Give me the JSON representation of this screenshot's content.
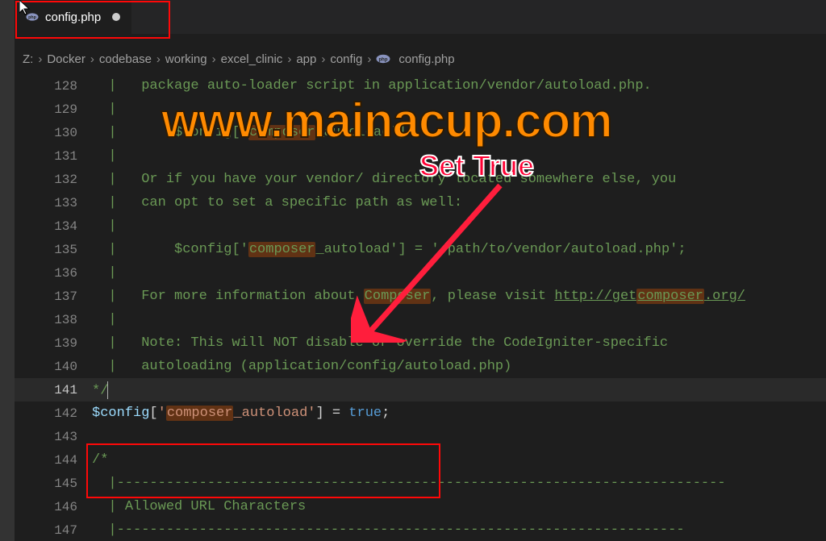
{
  "tab": {
    "filename": "config.php"
  },
  "breadcrumbs": {
    "items": [
      "Z:",
      "Docker",
      "codebase",
      "working",
      "excel_clinic",
      "app",
      "config",
      "config.php"
    ],
    "sep": "›"
  },
  "watermark": "www.mainacup.com",
  "annotation": "Set True",
  "lines": {
    "128": {
      "num": "128",
      "pipe": "  |   ",
      "text": "package auto-loader script in application/vendor/autoload.php."
    },
    "129": {
      "num": "129",
      "pipe": "  |"
    },
    "130": {
      "num": "130",
      "pipe": "  |       ",
      "v": "$config",
      "b1": "[",
      "s1": "'",
      "hl": "composer",
      "s2": "_autoload'",
      "b2": "]"
    },
    "131": {
      "num": "131",
      "pipe": "  |"
    },
    "132": {
      "num": "132",
      "pipe": "  |   ",
      "text": "Or if you have your vendor/ directory located somewhere else, you"
    },
    "133": {
      "num": "133",
      "pipe": "  |   ",
      "text": "can opt to set a specific path as well:"
    },
    "134": {
      "num": "134",
      "pipe": "  |"
    },
    "135": {
      "num": "135",
      "pipe": "  |       ",
      "v": "$config",
      "b1": "[",
      "s1": "'",
      "hl": "composer",
      "s2": "_autoload'",
      "b2": "]",
      "eq": " = ",
      "s3": "'/path/to/vendor/autoload.php'",
      "semi": ";"
    },
    "136": {
      "num": "136",
      "pipe": "  |"
    },
    "137": {
      "num": "137",
      "pipe": "  |   ",
      "t1": "For more information about ",
      "hl1": "Composer",
      "t2": ", please visit ",
      "u1": "http://get",
      "hlu": "composer",
      "u2": ".org/"
    },
    "138": {
      "num": "138",
      "pipe": "  |"
    },
    "139": {
      "num": "139",
      "pipe": "  |   ",
      "text": "Note: This will NOT disable or override the CodeIgniter-specific"
    },
    "140": {
      "num": "140",
      "pipe": "  |   ",
      "text": "autoloading (application/config/autoload.php)"
    },
    "141": {
      "num": "141",
      "text": "*/"
    },
    "142": {
      "num": "142",
      "v": "$config",
      "b1": "[",
      "s1": "'",
      "hl": "composer",
      "s2": "_autoload'",
      "b2": "]",
      "eq": " = ",
      "kw": "true",
      "semi": ";"
    },
    "143": {
      "num": "143"
    },
    "144": {
      "num": "144",
      "text": "/*"
    },
    "145": {
      "num": "145",
      "pipe": "  |",
      "dash": "--------------------------------------------------------------------------"
    },
    "146": {
      "num": "146",
      "pipe": "  | ",
      "text": "Allowed URL Characters"
    },
    "147": {
      "num": "147",
      "pipe": "  |",
      "dash": "---------------------------------------------------------------------"
    }
  }
}
